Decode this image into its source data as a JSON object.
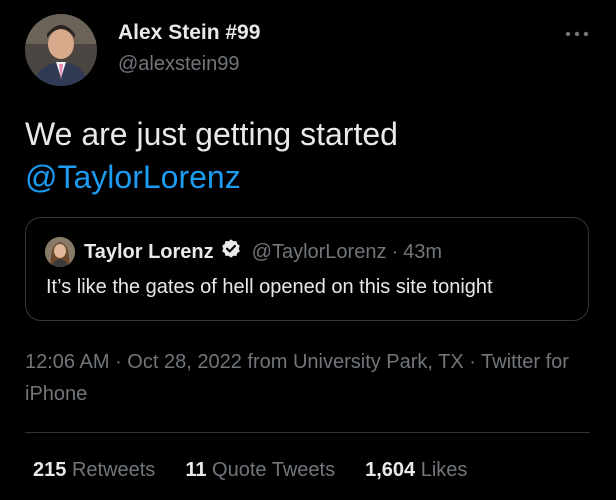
{
  "tweet": {
    "author": {
      "name": "Alex Stein #99",
      "handle": "@alexstein99"
    },
    "text_plain": "We are just getting started",
    "text_mention": "@TaylorLorenz",
    "quoted": {
      "name": "Taylor Lorenz",
      "handle": "@TaylorLorenz",
      "separator": "·",
      "time": "43m",
      "text": "It’s like the gates of hell opened on this site tonight",
      "verified": true
    },
    "meta": {
      "time": "12:06 AM",
      "sep1": " · ",
      "date": "Oct 28, 2022",
      "from_word": " from ",
      "location": "University Park, TX",
      "sep2": " · ",
      "source": "Twitter for iPhone"
    },
    "stats": [
      {
        "count": "215",
        "label": "Retweets"
      },
      {
        "count": "11",
        "label": "Quote Tweets"
      },
      {
        "count": "1,604",
        "label": "Likes"
      }
    ]
  },
  "colors": {
    "background": "#000000",
    "text": "#e7e9ea",
    "secondary": "#71767b",
    "accent": "#1d9bf0",
    "border": "#333639"
  },
  "icons": {
    "more": "more-horizontal-icon",
    "verified": "verified-badge-icon"
  }
}
